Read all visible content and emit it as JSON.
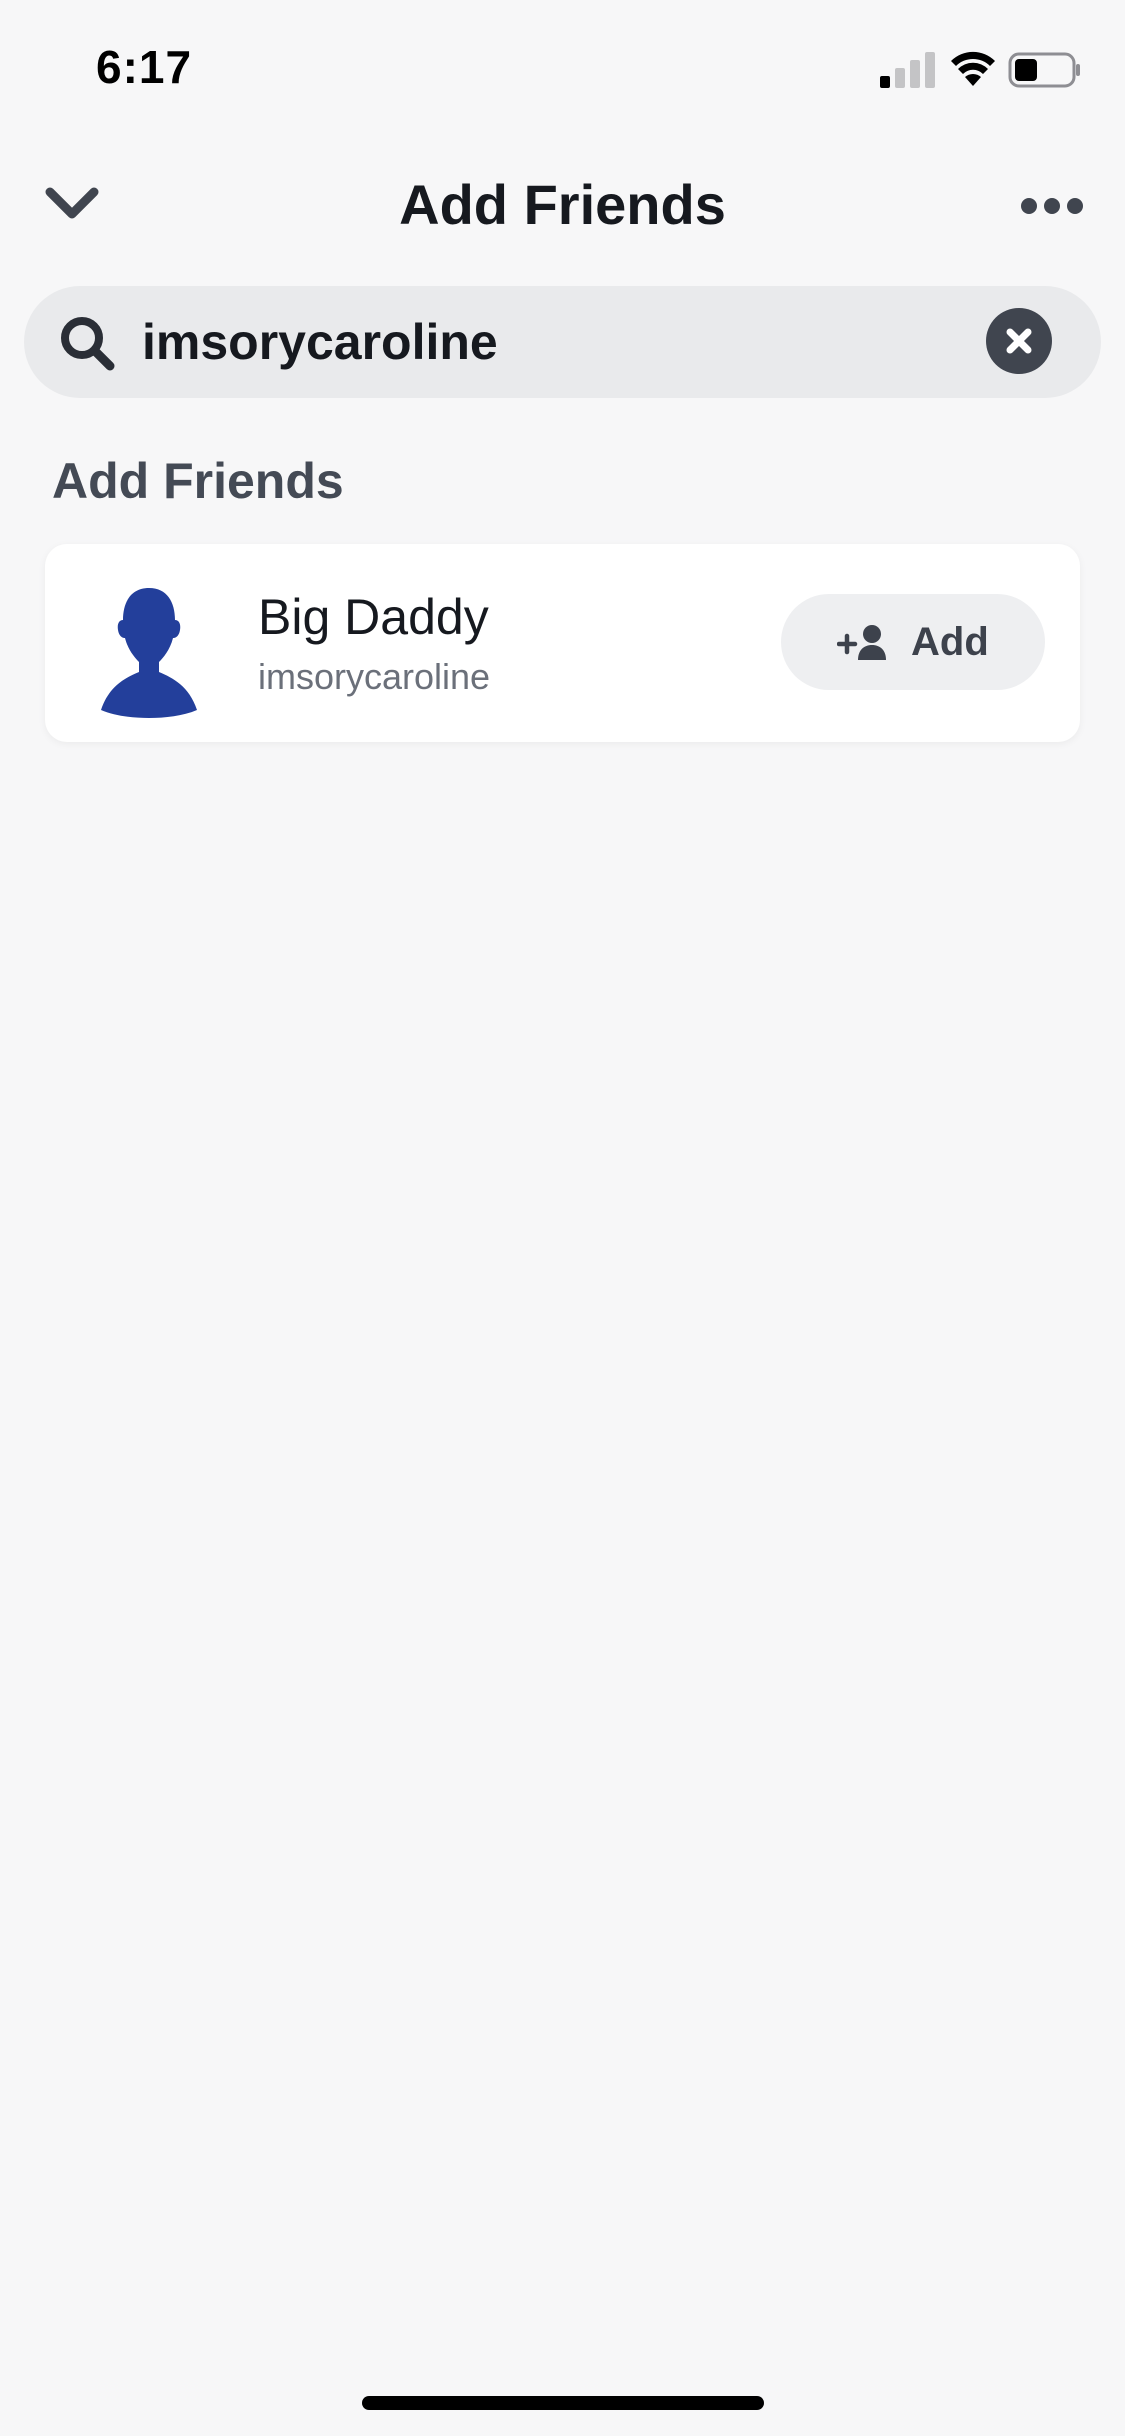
{
  "status_bar": {
    "time": "6:17",
    "signal_icon": "cellular-signal-icon",
    "wifi_icon": "wifi-icon",
    "battery_icon": "battery-icon",
    "battery_level": 0.4
  },
  "header": {
    "title": "Add Friends",
    "back_icon": "chevron-down-icon",
    "more_icon": "more-dots-icon"
  },
  "search": {
    "icon": "search-icon",
    "value": "imsorycaroline",
    "clear_icon": "clear-icon"
  },
  "section": {
    "title": "Add Friends"
  },
  "results": [
    {
      "name": "Big Daddy",
      "username": "imsorycaroline",
      "avatar_icon": "person-silhouette-icon",
      "add_icon": "add-friend-icon",
      "add_label": "Add"
    }
  ],
  "colors": {
    "background": "#f7f7f8",
    "avatar": "#233f9b",
    "text_primary": "#16191f",
    "text_secondary": "#6b707a",
    "search_bg": "#e9eaec",
    "button_bg": "#eeeff1"
  }
}
